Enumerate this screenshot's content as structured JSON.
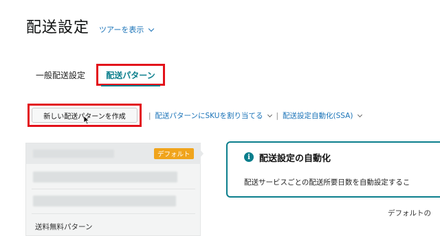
{
  "header": {
    "title": "配送設定",
    "tour_link": "ツアーを表示"
  },
  "tabs": [
    {
      "label": "一般配送設定",
      "active": false
    },
    {
      "label": "配送パターン",
      "active": true
    }
  ],
  "actions": {
    "create_button": "新しい配送パターンを作成",
    "assign_sku": "配送パターンにSKUを割り当てる",
    "automation": "配送設定自動化(SSA)"
  },
  "patterns": {
    "default_badge": "デフォルト",
    "free_shipping": "送料無料パターン"
  },
  "info_box": {
    "title": "配送設定の自動化",
    "body": "配送サービスごとの配送所要日数を自動設定するこ",
    "icon": "info-icon"
  },
  "footer_text": "デフォルトの",
  "colors": {
    "accent": "#0a7e8c",
    "link": "#1a73b8",
    "highlight_box": "#e3111a",
    "badge": "#f0a41c"
  }
}
